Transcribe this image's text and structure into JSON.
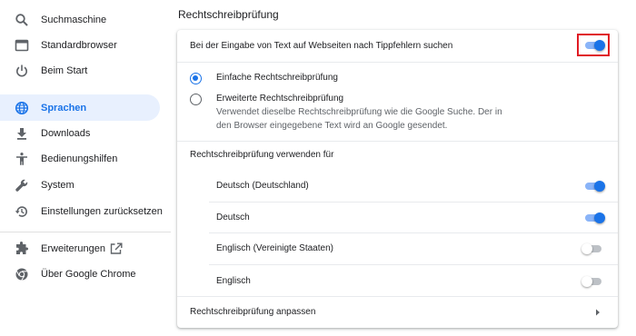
{
  "sidebar": {
    "items": [
      {
        "label": "Suchmaschine",
        "icon": "search-icon"
      },
      {
        "label": "Standardbrowser",
        "icon": "browser-window-icon"
      },
      {
        "label": "Beim Start",
        "icon": "power-icon"
      },
      {
        "label": "Sprachen",
        "icon": "globe-icon",
        "active": true
      },
      {
        "label": "Downloads",
        "icon": "download-icon"
      },
      {
        "label": "Bedienungshilfen",
        "icon": "accessibility-icon"
      },
      {
        "label": "System",
        "icon": "wrench-icon"
      },
      {
        "label": "Einstellungen zurücksetzen",
        "icon": "reset-history-icon"
      },
      {
        "label": "Erweiterungen",
        "icon": "puzzle-icon",
        "external": true
      },
      {
        "label": "Über Google Chrome",
        "icon": "chrome-icon"
      }
    ]
  },
  "main": {
    "section_title": "Rechtschreibprüfung",
    "spellcheck_toggle_label": "Bei der Eingabe von Text auf Webseiten nach Tippfehlern suchen",
    "spellcheck_enabled": true,
    "options": [
      {
        "label": "Einfache Rechtschreibprüfung",
        "selected": true
      },
      {
        "label": "Erweiterte Rechtschreibprüfung",
        "selected": false,
        "description": "Verwendet dieselbe Rechtschreibprüfung wie die Google Suche. Der in den Browser eingegebene Text wird an Google gesendet."
      }
    ],
    "languages_heading": "Rechtschreibprüfung verwenden für",
    "languages": [
      {
        "label": "Deutsch (Deutschland)",
        "enabled": true
      },
      {
        "label": "Deutsch",
        "enabled": true
      },
      {
        "label": "Englisch (Vereinigte Staaten)",
        "enabled": false
      },
      {
        "label": "Englisch",
        "enabled": false
      }
    ],
    "customize_label": "Rechtschreibprüfung anpassen"
  },
  "colors": {
    "accent": "#1a73e8",
    "active_nav_bg": "#e8f0fe",
    "highlight_border": "#e01b24"
  }
}
